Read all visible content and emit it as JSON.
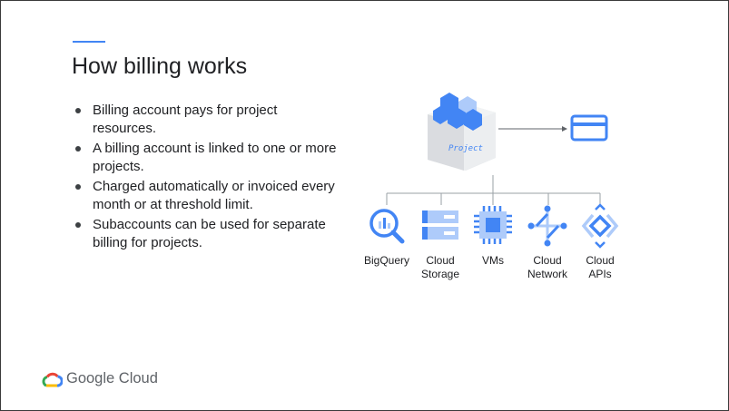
{
  "slide": {
    "title": "How billing works",
    "bullets": [
      "Billing account pays for project resources.",
      "A billing account is linked to one or more projects.",
      "Charged automatically or invoiced every month or at threshold limit.",
      "Subaccounts can be used for separate billing for projects."
    ]
  },
  "diagram": {
    "project_label": "Project",
    "billing_icon": "credit-card-icon",
    "services": [
      {
        "label_line1": "BigQuery",
        "label_line2": "",
        "icon": "bigquery-icon"
      },
      {
        "label_line1": "Cloud",
        "label_line2": "Storage",
        "icon": "cloud-storage-icon"
      },
      {
        "label_line1": "VMs",
        "label_line2": "",
        "icon": "vm-chip-icon"
      },
      {
        "label_line1": "Cloud",
        "label_line2": "Network",
        "icon": "cloud-network-icon"
      },
      {
        "label_line1": "Cloud",
        "label_line2": "APIs",
        "icon": "cloud-apis-icon"
      }
    ]
  },
  "footer": {
    "logo_text": "Google Cloud"
  },
  "colors": {
    "accent": "#4285f4",
    "icon_blue": "#4285f4",
    "icon_light_blue": "#aecbfa",
    "text": "#202124",
    "line": "#9aa0a6"
  }
}
